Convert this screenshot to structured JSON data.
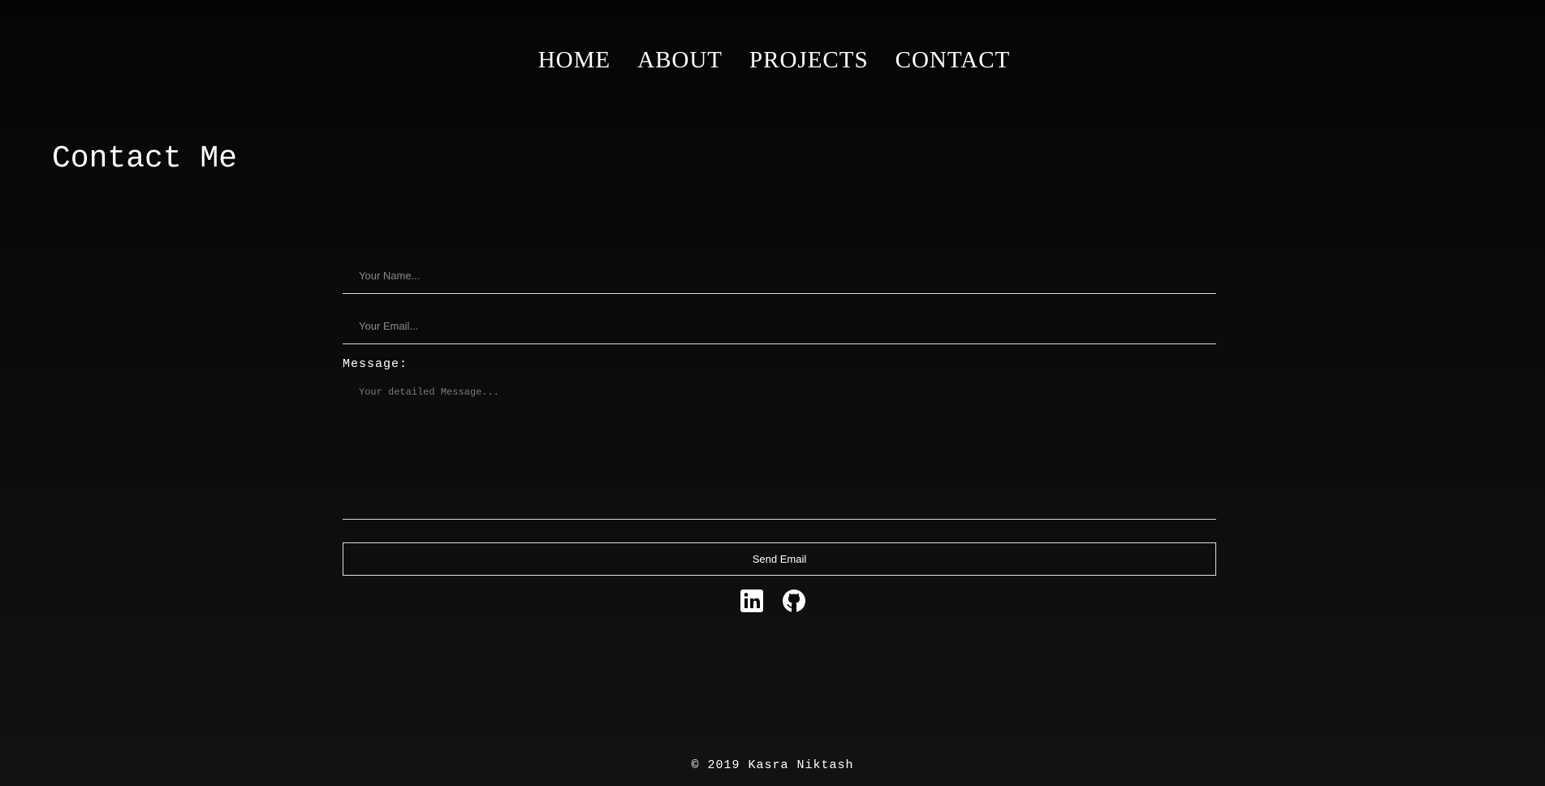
{
  "nav": {
    "items": [
      {
        "label": "HOME"
      },
      {
        "label": "ABOUT"
      },
      {
        "label": "PROJECTS"
      },
      {
        "label": "CONTACT"
      }
    ]
  },
  "page": {
    "title": "Contact Me"
  },
  "form": {
    "name_placeholder": "Your Name...",
    "name_value": "",
    "email_placeholder": "Your Email...",
    "email_value": "",
    "message_label": "Message:",
    "message_placeholder": "Your detailed Message...",
    "message_value": "",
    "submit_label": "Send Email"
  },
  "social": {
    "icons": [
      "linkedin-icon",
      "github-icon"
    ]
  },
  "footer": {
    "copyright": "© 2019 Kasra Niktash"
  },
  "colors": {
    "background_top": "#050505",
    "background_bottom": "#121212",
    "text": "#ffffff",
    "border": "#d9d9d9",
    "placeholder": "#8a8a8a"
  }
}
